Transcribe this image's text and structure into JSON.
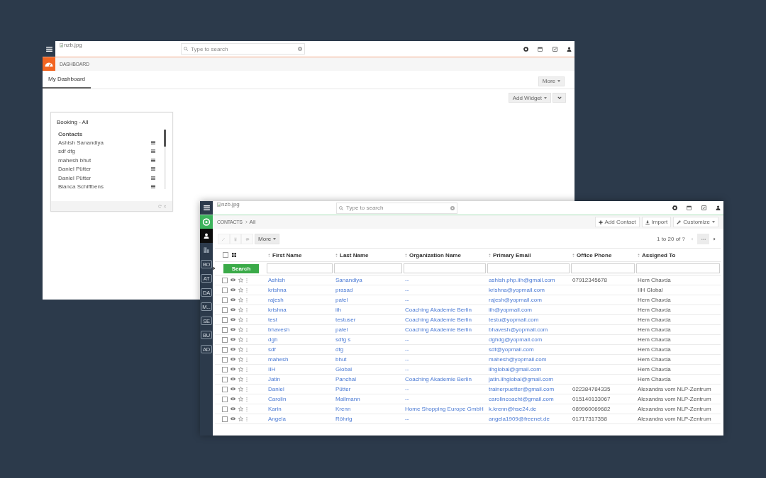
{
  "dashboard_window": {
    "logo": "nzb.jpg",
    "search": {
      "placeholder": "Type to search"
    },
    "module": "DASHBOARD",
    "tabs": [
      {
        "label": "My Dashboard",
        "selected": true
      }
    ],
    "more_button": "More",
    "add_widget_button": "Add Widget",
    "widget": {
      "title": "Booking - All",
      "section": "Contacts",
      "items": [
        "Ashish Sanandiya",
        "sdf dfg",
        "mahesh bhut",
        "Daniel Pütter",
        "Daniel Pütter",
        "Bianca Schiffbens"
      ]
    }
  },
  "contacts_window": {
    "logo": "nzb.jpg",
    "search": {
      "placeholder": "Type to search"
    },
    "sidebar": {
      "items": [
        {
          "kind": "person",
          "selected": true
        },
        {
          "kind": "building",
          "selected": false
        },
        {
          "kind": "label",
          "label": "BO",
          "selected": false
        },
        {
          "kind": "label",
          "label": "AT",
          "selected": false
        },
        {
          "kind": "label",
          "label": "DA",
          "selected": false
        },
        {
          "kind": "label",
          "label": "M...",
          "selected": false
        },
        {
          "kind": "label",
          "label": "SE",
          "selected": false
        },
        {
          "kind": "label",
          "label": "BU",
          "selected": false
        },
        {
          "kind": "label",
          "label": "AD",
          "selected": false
        }
      ]
    },
    "module": "CONTACTS",
    "breadcrumb": "All",
    "header_buttons": [
      {
        "kind": "add",
        "label": "Add Contact"
      },
      {
        "kind": "import",
        "label": "Import"
      },
      {
        "kind": "customize",
        "label": "Customize"
      }
    ],
    "toolbar": {
      "actions": [
        {
          "kind": "edit",
          "disabled": true
        },
        {
          "kind": "delete",
          "disabled": true
        },
        {
          "kind": "comment",
          "disabled": true
        }
      ],
      "more_button": "More"
    },
    "pagination": {
      "range": "1 to 20 of ?",
      "previous_disabled": true,
      "next_disabled": false
    },
    "table": {
      "select_all_checked": false,
      "columns": [
        "First Name",
        "Last Name",
        "Organization Name",
        "Primary Email",
        "Office Phone",
        "Assigned To"
      ],
      "search_button": "Search",
      "rows": [
        {
          "checked": false,
          "starred": false,
          "first_name": "Ashish",
          "last_name": "Sanandiya",
          "organization": "--",
          "email": "ashish.php.iih@gmail.com",
          "phone": "07912345678",
          "assigned_to": "Hem Chavda"
        },
        {
          "checked": false,
          "starred": false,
          "first_name": "krishna",
          "last_name": "prasad",
          "organization": "--",
          "email": "krishna@yopmail.com",
          "assigned_to": "IIH Global"
        },
        {
          "checked": false,
          "starred": false,
          "first_name": "rajesh",
          "last_name": "patel",
          "organization": "--",
          "email": "rajesh@yopmail.com",
          "assigned_to": "Hem Chavda"
        },
        {
          "checked": false,
          "starred": false,
          "first_name": "krishna",
          "last_name": "iih",
          "organization": "Coaching Akademie Berlin",
          "email": "iih@yopmail.com",
          "assigned_to": "Hem Chavda"
        },
        {
          "checked": false,
          "starred": false,
          "first_name": "test",
          "last_name": "testuser",
          "organization": "Coaching Akademie Berlin",
          "email": "testu@yopmail.com",
          "assigned_to": "Hem Chavda"
        },
        {
          "checked": false,
          "starred": false,
          "first_name": "bhavesh",
          "last_name": "patel",
          "organization": "Coaching Akademie Berlin",
          "email": "bhavesh@yopmail.com",
          "assigned_to": "Hem Chavda"
        },
        {
          "checked": false,
          "starred": false,
          "first_name": "dgh",
          "last_name": "sdfg s",
          "organization": "--",
          "email": "dghdg@yopmail.com",
          "assigned_to": "Hem Chavda"
        },
        {
          "checked": false,
          "starred": false,
          "first_name": "sdf",
          "last_name": "dfg",
          "organization": "--",
          "email": "sdf@yopmail.com",
          "assigned_to": "Hem Chavda"
        },
        {
          "checked": false,
          "starred": false,
          "first_name": "mahesh",
          "last_name": "bhut",
          "organization": "--",
          "email": "mahesh@yopmail.com",
          "assigned_to": "Hem Chavda"
        },
        {
          "checked": false,
          "starred": false,
          "first_name": "IIH",
          "last_name": "Global",
          "organization": "--",
          "email": "iihglobal@gmail.com",
          "assigned_to": "Hem Chavda"
        },
        {
          "checked": false,
          "starred": false,
          "first_name": "Jatin",
          "last_name": "Panchal",
          "organization": "Coaching Akademie Berlin",
          "email": "jatin.iihglobal@gmail.com",
          "assigned_to": "Hem Chavda"
        },
        {
          "checked": false,
          "starred": false,
          "first_name": "Daniel",
          "last_name": "Pütter",
          "organization": "--",
          "email": "trainerpuetter@gmail.com",
          "phone": "022384784335",
          "assigned_to": "Alexandra vom NLP-Zentrum"
        },
        {
          "checked": false,
          "starred": false,
          "first_name": "Carolin",
          "last_name": "Mallmann",
          "organization": "--",
          "email": "carolincoacht@gmail.com",
          "phone": "015140133067",
          "assigned_to": "Alexandra vom NLP-Zentrum"
        },
        {
          "checked": false,
          "starred": false,
          "first_name": "Karin",
          "last_name": "Krenn",
          "organization": "Home Shopping Europe GmbH",
          "email": "k.krenn@hse24.de",
          "phone": "089960069682",
          "assigned_to": "Alexandra vom NLP-Zentrum"
        },
        {
          "checked": false,
          "starred": false,
          "first_name": "Angela",
          "last_name": "Röhrig",
          "organization": "--",
          "email": "angela1909@freenet.de",
          "phone": "01717317358",
          "assigned_to": "Alexandra vom NLP-Zentrum"
        }
      ]
    }
  }
}
